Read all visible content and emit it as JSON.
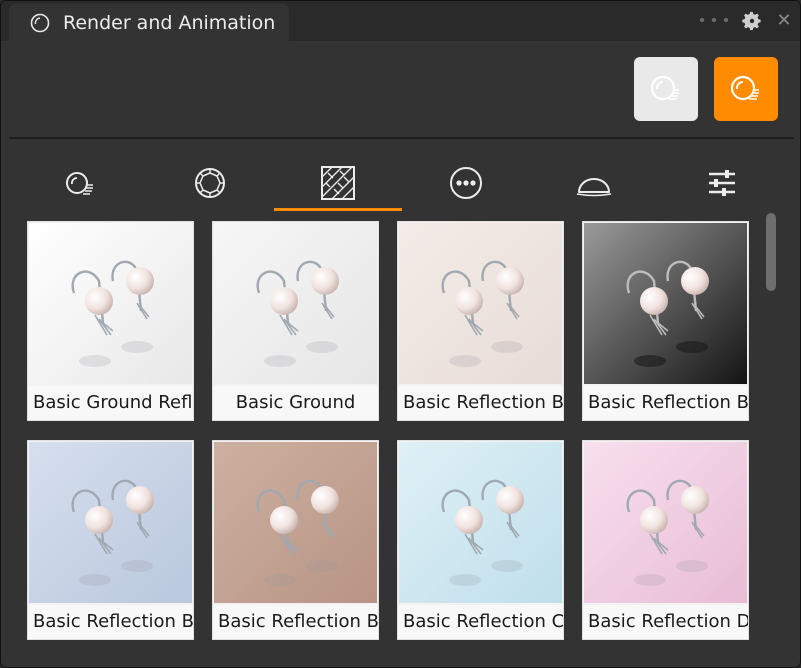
{
  "window": {
    "title": "Render and Animation"
  },
  "toolbar": {
    "render_buttons": [
      {
        "icon": "render-preview-icon",
        "state": "inactive",
        "color": "#e9e9e9"
      },
      {
        "icon": "render-active-icon",
        "state": "active",
        "color": "#ff8c00"
      }
    ]
  },
  "category_tabs": [
    {
      "icon": "render-sphere-icon"
    },
    {
      "icon": "gem-icon"
    },
    {
      "icon": "environment-pattern-icon",
      "selected": true
    },
    {
      "icon": "more-options-icon"
    },
    {
      "icon": "dome-icon"
    },
    {
      "icon": "sliders-icon"
    }
  ],
  "accent_color": "#ff8c00",
  "presets": [
    {
      "label": "Basic Ground Refl",
      "bg": [
        "#ffffff",
        "#e8e8e8"
      ]
    },
    {
      "label": "Basic Ground",
      "bg": [
        "#f6f6f6",
        "#e6e6e6"
      ]
    },
    {
      "label": "Basic Reflection B",
      "bg": [
        "#f4ece8",
        "#e8dcd6"
      ]
    },
    {
      "label": "Basic Reflection B",
      "bg": [
        "#9a9a9a",
        "#141414"
      ]
    },
    {
      "label": "Basic Reflection B",
      "bg": [
        "#d6dfee",
        "#b9c8dd"
      ]
    },
    {
      "label": "Basic Reflection B",
      "bg": [
        "#cdb0a1",
        "#b89484"
      ]
    },
    {
      "label": "Basic Reflection C",
      "bg": [
        "#dff0f6",
        "#bfdfeb"
      ]
    },
    {
      "label": "Basic Reflection D",
      "bg": [
        "#f8e0ee",
        "#e8bcd6"
      ]
    }
  ]
}
